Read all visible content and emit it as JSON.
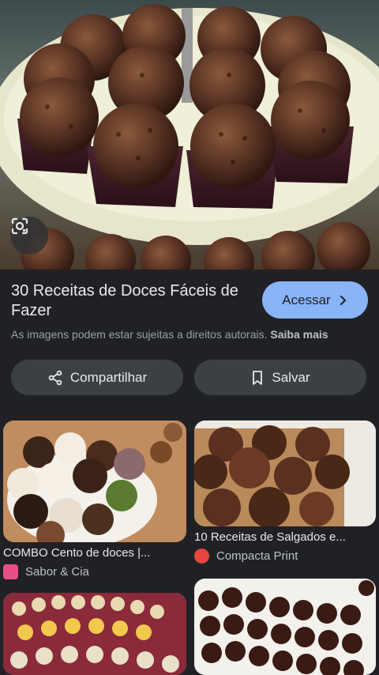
{
  "hero": {
    "lens_icon": "google-lens-icon"
  },
  "result": {
    "title": "30 Receitas de Doces Fáceis de Fazer",
    "visit_label": "Acessar",
    "visit_icon": "chevron-right-icon",
    "copyright_notice": "As imagens podem estar sujeitas a direitos autorais.",
    "learn_more": "Saiba mais"
  },
  "actions": {
    "share_label": "Compartilhar",
    "share_icon": "share-icon",
    "save_label": "Salvar",
    "save_icon": "bookmark-icon"
  },
  "related": [
    {
      "caption": "COMBO Cento de doces |...",
      "source": "Sabor & Cia",
      "favicon_color": "#e94f84"
    },
    {
      "caption": "10 Receitas de Salgados e...",
      "source": "Compacta Print",
      "favicon_color": "#e8453c"
    },
    {
      "caption": "",
      "source": ""
    },
    {
      "caption": "",
      "source": ""
    }
  ],
  "colors": {
    "background": "#202124",
    "accent": "#8ab4f8",
    "button_bg": "#3c4043"
  }
}
